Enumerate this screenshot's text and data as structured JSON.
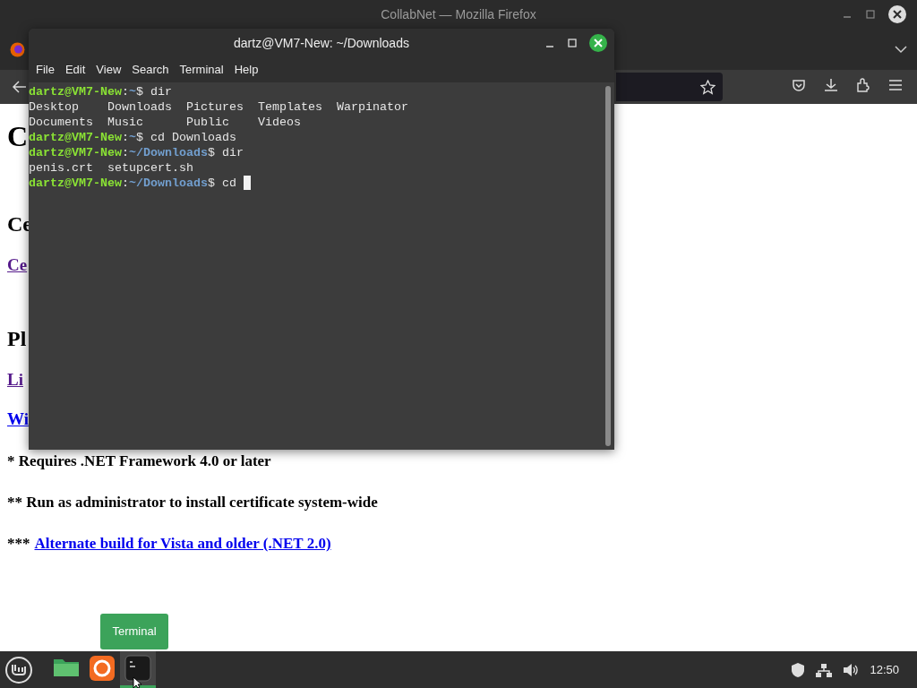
{
  "browser": {
    "title": "CollabNet — Mozilla Firefox"
  },
  "page": {
    "blocks": [
      {
        "kind": "h1",
        "text": "C"
      },
      {
        "kind": "h2",
        "text": "Ce"
      },
      {
        "kind": "link",
        "text": "Ce",
        "visited": true
      },
      {
        "kind": "h2",
        "text": "Pl"
      },
      {
        "kind": "link",
        "text": "Li",
        "visited": true
      },
      {
        "kind": "link",
        "text": "Wi",
        "visited": false
      },
      {
        "kind": "note",
        "text": "* Requires .NET Framework 4.0 or later"
      },
      {
        "kind": "note",
        "text": "** Run as administrator to install certificate system-wide"
      },
      {
        "kind": "note_link",
        "prefix": "***",
        "text": "Alternate build for Vista and older (.NET 2.0)"
      }
    ]
  },
  "terminal": {
    "title": "dartz@VM7-New: ~/Downloads",
    "menu": [
      "File",
      "Edit",
      "View",
      "Search",
      "Terminal",
      "Help"
    ],
    "lines": [
      {
        "kind": "prompt",
        "user": "dartz@VM7-New",
        "separator": ":",
        "path": "~",
        "command": "$ dir"
      },
      {
        "kind": "output",
        "text": "Desktop    Downloads  Pictures  Templates  Warpinator"
      },
      {
        "kind": "output",
        "text": "Documents  Music      Public    Videos"
      },
      {
        "kind": "prompt",
        "user": "dartz@VM7-New",
        "separator": ":",
        "path": "~",
        "command": "$ cd Downloads"
      },
      {
        "kind": "prompt",
        "user": "dartz@VM7-New",
        "separator": ":",
        "path": "~/Downloads",
        "command": "$ dir"
      },
      {
        "kind": "output",
        "text": "penis.crt  setupcert.sh"
      },
      {
        "kind": "prompt",
        "user": "dartz@VM7-New",
        "separator": ":",
        "path": "~/Downloads",
        "command": "$ cd ",
        "cursor": true
      }
    ]
  },
  "tooltip": "Terminal",
  "taskbar": {
    "apps": [
      {
        "kind": "files",
        "selected": false
      },
      {
        "kind": "firefox",
        "selected": false
      },
      {
        "kind": "terminal",
        "selected": true
      }
    ],
    "clock": "12:50"
  }
}
